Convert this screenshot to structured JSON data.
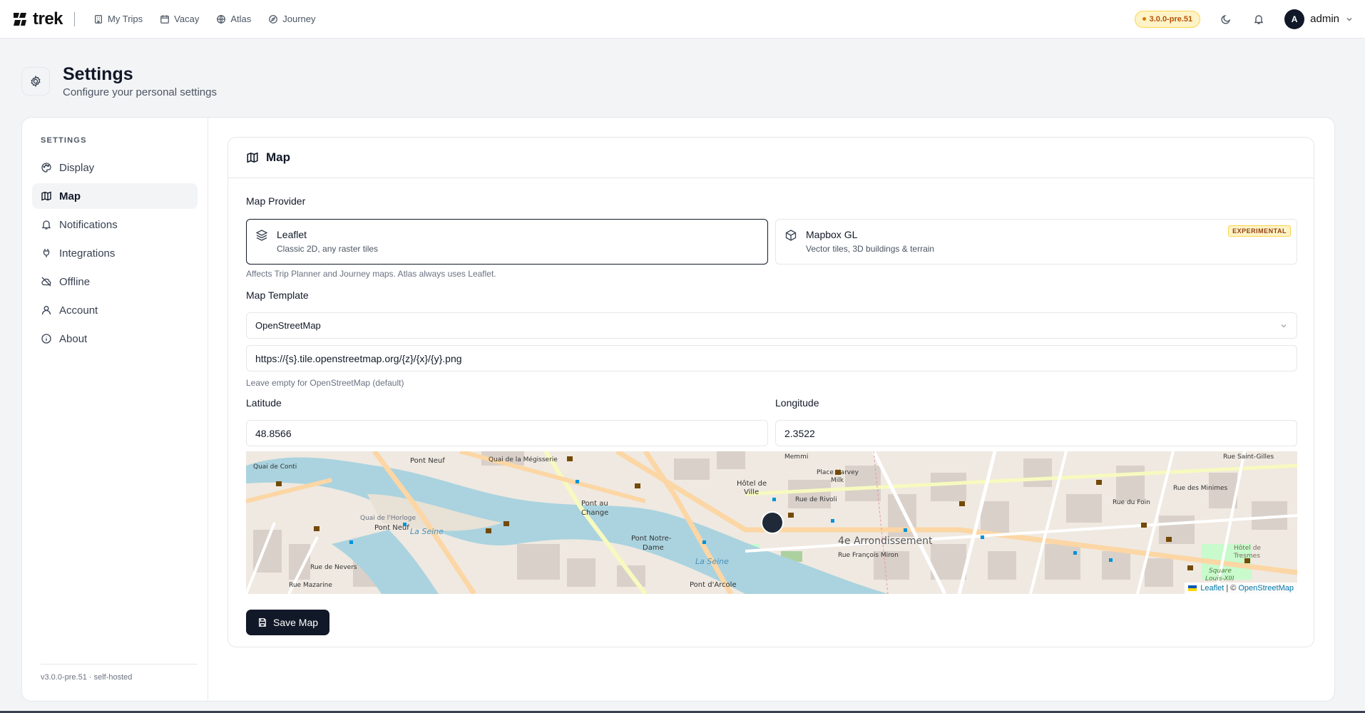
{
  "topbar": {
    "logo_text": "trek",
    "nav": [
      {
        "label": "My Trips",
        "icon": "building-icon"
      },
      {
        "label": "Vacay",
        "icon": "calendar-icon"
      },
      {
        "label": "Atlas",
        "icon": "globe-icon"
      },
      {
        "label": "Journey",
        "icon": "compass-icon"
      }
    ],
    "version": "3.0.0-pre.51",
    "user": {
      "initial": "A",
      "name": "admin"
    }
  },
  "header": {
    "title": "Settings",
    "subtitle": "Configure your personal settings"
  },
  "sidebar": {
    "heading": "SETTINGS",
    "items": [
      {
        "label": "Display",
        "icon": "palette-icon"
      },
      {
        "label": "Map",
        "icon": "map-icon",
        "active": true
      },
      {
        "label": "Notifications",
        "icon": "bell-icon"
      },
      {
        "label": "Integrations",
        "icon": "plug-icon"
      },
      {
        "label": "Offline",
        "icon": "cloud-off-icon"
      },
      {
        "label": "Account",
        "icon": "user-icon"
      },
      {
        "label": "About",
        "icon": "info-icon"
      }
    ],
    "footer": "v3.0.0-pre.51 · self-hosted"
  },
  "panel": {
    "title": "Map",
    "provider_label": "Map Provider",
    "providers": [
      {
        "name": "Leaflet",
        "desc": "Classic 2D, any raster tiles",
        "selected": true
      },
      {
        "name": "Mapbox GL",
        "desc": "Vector tiles, 3D buildings & terrain",
        "badge": "EXPERIMENTAL"
      }
    ],
    "provider_hint": "Affects Trip Planner and Journey maps. Atlas always uses Leaflet.",
    "template_label": "Map Template",
    "template_value": "OpenStreetMap",
    "tile_url": "https://{s}.tile.openstreetmap.org/{z}/{x}/{y}.png",
    "tile_hint": "Leave empty for OpenStreetMap (default)",
    "latitude_label": "Latitude",
    "latitude": "48.8566",
    "longitude_label": "Longitude",
    "longitude": "2.3522",
    "map_labels": {
      "pont_neuf_1": "Pont Neuf",
      "pont_neuf_2": "Pont Neuf",
      "pont_au_change": "Pont au",
      "pont_au_change_2": "Change",
      "pont_notre_dame": "Pont Notre-",
      "pont_notre_dame_2": "Dame",
      "pont_darcole": "Pont d'Arcole",
      "hotel_de_ville": "Hôtel de",
      "hotel_de_ville_2": "Ville",
      "arrondissement": "4e Arrondissement",
      "quai_conti": "Quai de Conti",
      "quai_horloge": "Quai de l'Horloge",
      "la_seine": "La Seine",
      "la_seine_2": "La Seine",
      "rue_rivoli": "Rue de Rivoli",
      "rue_st_antoine": "Rue François Miron",
      "place_harvey": "Place Harvey",
      "place_harvey_2": "Milk",
      "square": "Square",
      "square_2": "Louis-XIII",
      "hotel_tresmes": "Hôtel de",
      "hotel_tresmes_2": "Tresmes",
      "memmi": "Memmi",
      "rue_mazarine": "Rue Mazarine",
      "rue_nevers": "Rue de Nevers",
      "rue_du_foin": "Rue du Foin",
      "rue_des_minimes": "Rue des Minimes",
      "rue_saint_gilles": "Rue Saint-Gilles",
      "quai_megisserie": "Quai de la Mégisserie"
    },
    "attribution_leaflet": "Leaflet",
    "attribution_sep": "| ©",
    "attribution_osm": "OpenStreetMap",
    "save_label": "Save Map"
  },
  "colors": {
    "accent": "#111827",
    "version_bg": "#fef3c7",
    "version_text": "#b45309",
    "water": "#aad3df",
    "road": "#f7fabf",
    "road_orange": "#fcd6a4"
  }
}
